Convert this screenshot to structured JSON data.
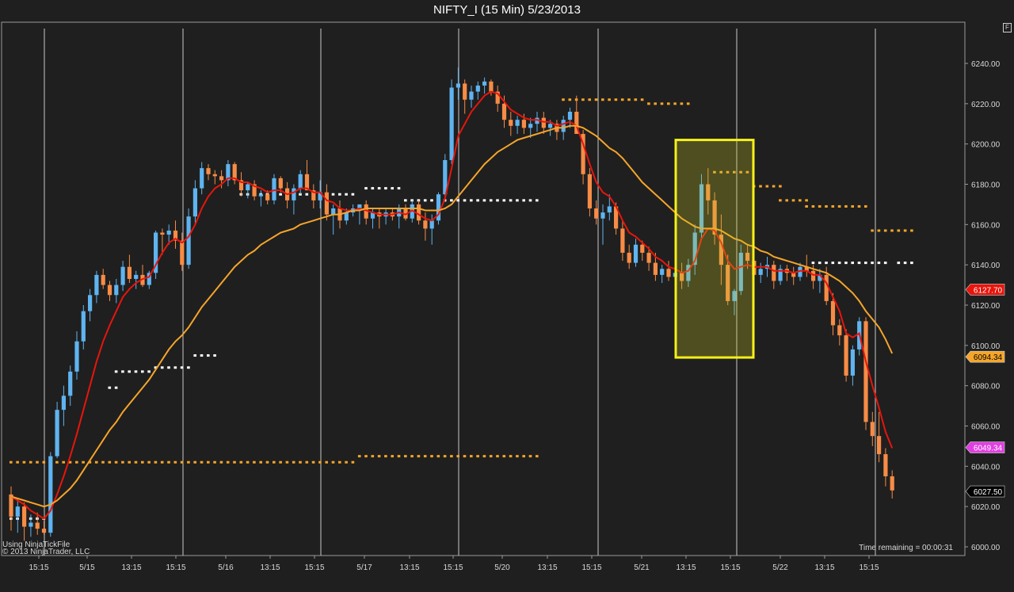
{
  "window": {
    "title": "NIFTY_I (15 Min)  5/23/2013",
    "corner_button": "F"
  },
  "footer": {
    "source_line": "Using NinjaTickFile",
    "copyright": "© 2013 NinjaTrader, LLC",
    "time_remaining": "Time remaining = 00:00:31"
  },
  "colors": {
    "background": "#1f1f1f",
    "up_candle": "#5fb4f0",
    "down_candle": "#f78c46",
    "fast_ma": "#e8150c",
    "slow_ma": "#f5a52a",
    "highlight_box": "#f6f018"
  },
  "chart_data": {
    "type": "candlestick",
    "title": "NIFTY_I (15 Min)  5/23/2013",
    "interval": "15 Min",
    "ylim": [
      5995,
      6253
    ],
    "y_ticks": [
      6000,
      6020,
      6040,
      6060,
      6080,
      6100,
      6120,
      6140,
      6160,
      6180,
      6200,
      6220,
      6240
    ],
    "y_tick_labels": [
      "6000.00",
      "6020.00",
      "6040.00",
      "6060.00",
      "6080.00",
      "6100.00",
      "6120.00",
      "6140.00",
      "6160.00",
      "6180.00",
      "6200.00",
      "6220.00",
      "6240.00"
    ],
    "x_tick_labels": [
      "15:15",
      "5/15",
      "13:15",
      "15:15",
      "5/16",
      "13:15",
      "15:15",
      "5/17",
      "13:15",
      "15:15",
      "5/20",
      "13:15",
      "15:15",
      "5/21",
      "13:15",
      "15:15",
      "5/22",
      "13:15",
      "15:15"
    ],
    "day_separators": 7,
    "candles": [
      [
        6026,
        6030,
        6008,
        6015
      ],
      [
        6015,
        6024,
        6007,
        6020
      ],
      [
        6020,
        6022,
        6003,
        6010
      ],
      [
        6010,
        6016,
        6005,
        6012
      ],
      [
        6012,
        6017,
        6006,
        6009
      ],
      [
        6009,
        6013,
        6006,
        6007
      ],
      [
        6007,
        6047,
        6005,
        6045
      ],
      [
        6045,
        6072,
        6044,
        6068
      ],
      [
        6068,
        6080,
        6060,
        6075
      ],
      [
        6075,
        6090,
        6070,
        6087
      ],
      [
        6087,
        6107,
        6083,
        6102
      ],
      [
        6102,
        6120,
        6098,
        6117
      ],
      [
        6117,
        6128,
        6112,
        6125
      ],
      [
        6125,
        6137,
        6121,
        6135
      ],
      [
        6135,
        6138,
        6128,
        6130
      ],
      [
        6130,
        6132,
        6122,
        6125
      ],
      [
        6125,
        6133,
        6121,
        6130
      ],
      [
        6130,
        6142,
        6127,
        6139
      ],
      [
        6139,
        6145,
        6131,
        6133
      ],
      [
        6133,
        6137,
        6128,
        6135
      ],
      [
        6135,
        6140,
        6129,
        6130
      ],
      [
        6130,
        6137,
        6128,
        6136
      ],
      [
        6136,
        6157,
        6133,
        6156
      ],
      [
        6156,
        6158,
        6145,
        6155
      ],
      [
        6155,
        6160,
        6150,
        6157
      ],
      [
        6157,
        6162,
        6148,
        6152
      ],
      [
        6152,
        6156,
        6137,
        6140
      ],
      [
        6140,
        6168,
        6138,
        6164
      ],
      [
        6164,
        6182,
        6160,
        6178
      ],
      [
        6178,
        6191,
        6175,
        6188
      ],
      [
        6188,
        6190,
        6182,
        6185
      ],
      [
        6185,
        6187,
        6180,
        6184
      ],
      [
        6184,
        6187,
        6178,
        6182
      ],
      [
        6182,
        6192,
        6179,
        6190
      ],
      [
        6190,
        6191,
        6180,
        6182
      ],
      [
        6182,
        6186,
        6174,
        6177
      ],
      [
        6177,
        6181,
        6173,
        6180
      ],
      [
        6180,
        6182,
        6172,
        6174
      ],
      [
        6174,
        6177,
        6169,
        6175
      ],
      [
        6175,
        6177,
        6170,
        6172
      ],
      [
        6172,
        6185,
        6170,
        6183
      ],
      [
        6183,
        6184,
        6176,
        6178
      ],
      [
        6178,
        6181,
        6168,
        6172
      ],
      [
        6172,
        6180,
        6165,
        6178
      ],
      [
        6178,
        6187,
        6175,
        6185
      ],
      [
        6185,
        6192,
        6180,
        6177
      ],
      [
        6177,
        6180,
        6168,
        6172
      ],
      [
        6172,
        6182,
        6168,
        6176
      ],
      [
        6176,
        6180,
        6162,
        6165
      ],
      [
        6165,
        6170,
        6155,
        6168
      ],
      [
        6168,
        6172,
        6158,
        6162
      ],
      [
        6162,
        6168,
        6160,
        6166
      ],
      [
        6166,
        6170,
        6164,
        6168
      ],
      [
        6168,
        6170,
        6160,
        6170
      ],
      [
        6170,
        6172,
        6160,
        6163
      ],
      [
        6163,
        6168,
        6158,
        6166
      ],
      [
        6166,
        6168,
        6158,
        6164
      ],
      [
        6164,
        6168,
        6160,
        6166
      ],
      [
        6166,
        6168,
        6162,
        6164
      ],
      [
        6164,
        6170,
        6158,
        6168
      ],
      [
        6168,
        6170,
        6162,
        6163
      ],
      [
        6163,
        6172,
        6161,
        6170
      ],
      [
        6170,
        6172,
        6160,
        6162
      ],
      [
        6162,
        6166,
        6152,
        6158
      ],
      [
        6158,
        6165,
        6150,
        6162
      ],
      [
        6162,
        6176,
        6160,
        6175
      ],
      [
        6175,
        6195,
        6172,
        6192
      ],
      [
        6192,
        6232,
        6190,
        6228
      ],
      [
        6228,
        6238,
        6222,
        6230
      ],
      [
        6230,
        6232,
        6215,
        6222
      ],
      [
        6222,
        6229,
        6218,
        6226
      ],
      [
        6226,
        6231,
        6222,
        6229
      ],
      [
        6229,
        6233,
        6225,
        6231
      ],
      [
        6231,
        6232,
        6224,
        6226
      ],
      [
        6226,
        6229,
        6216,
        6220
      ],
      [
        6220,
        6224,
        6208,
        6212
      ],
      [
        6212,
        6216,
        6204,
        6209
      ],
      [
        6209,
        6214,
        6205,
        6212
      ],
      [
        6212,
        6215,
        6205,
        6208
      ],
      [
        6208,
        6213,
        6203,
        6210
      ],
      [
        6210,
        6216,
        6206,
        6213
      ],
      [
        6213,
        6216,
        6205,
        6208
      ],
      [
        6208,
        6212,
        6204,
        6210
      ],
      [
        6210,
        6212,
        6202,
        6206
      ],
      [
        6206,
        6214,
        6202,
        6212
      ],
      [
        6212,
        6218,
        6208,
        6216
      ],
      [
        6216,
        6224,
        6210,
        6205
      ],
      [
        6205,
        6207,
        6180,
        6185
      ],
      [
        6185,
        6188,
        6164,
        6168
      ],
      [
        6168,
        6172,
        6160,
        6163
      ],
      [
        6163,
        6170,
        6150,
        6166
      ],
      [
        6166,
        6175,
        6162,
        6169
      ],
      [
        6169,
        6171,
        6155,
        6158
      ],
      [
        6158,
        6162,
        6142,
        6146
      ],
      [
        6146,
        6150,
        6138,
        6141
      ],
      [
        6141,
        6153,
        6139,
        6150
      ],
      [
        6150,
        6152,
        6142,
        6146
      ],
      [
        6146,
        6149,
        6137,
        6141
      ],
      [
        6141,
        6146,
        6132,
        6135
      ],
      [
        6135,
        6140,
        6131,
        6138
      ],
      [
        6138,
        6142,
        6132,
        6134
      ],
      [
        6134,
        6140,
        6130,
        6136
      ],
      [
        6136,
        6141,
        6128,
        6132
      ],
      [
        6132,
        6143,
        6129,
        6140
      ],
      [
        6140,
        6160,
        6135,
        6156
      ],
      [
        6156,
        6185,
        6153,
        6180
      ],
      [
        6180,
        6188,
        6165,
        6172
      ],
      [
        6172,
        6176,
        6150,
        6155
      ],
      [
        6155,
        6165,
        6130,
        6140
      ],
      [
        6140,
        6145,
        6120,
        6122
      ],
      [
        6122,
        6128,
        6115,
        6127
      ],
      [
        6127,
        6150,
        6125,
        6146
      ],
      [
        6146,
        6150,
        6138,
        6142
      ],
      [
        6142,
        6145,
        6130,
        6135
      ],
      [
        6135,
        6141,
        6131,
        6138
      ],
      [
        6138,
        6144,
        6134,
        6140
      ],
      [
        6140,
        6142,
        6128,
        6132
      ],
      [
        6132,
        6140,
        6130,
        6138
      ],
      [
        6138,
        6140,
        6132,
        6136
      ],
      [
        6136,
        6139,
        6130,
        6134
      ],
      [
        6134,
        6141,
        6132,
        6139
      ],
      [
        6139,
        6145,
        6134,
        6137
      ],
      [
        6137,
        6140,
        6128,
        6132
      ],
      [
        6132,
        6138,
        6126,
        6135
      ],
      [
        6135,
        6139,
        6120,
        6122
      ],
      [
        6122,
        6126,
        6105,
        6110
      ],
      [
        6110,
        6113,
        6100,
        6105
      ],
      [
        6105,
        6108,
        6082,
        6085
      ],
      [
        6085,
        6100,
        6080,
        6098
      ],
      [
        6098,
        6114,
        6095,
        6112
      ],
      [
        6112,
        6114,
        6058,
        6062
      ],
      [
        6062,
        6067,
        6050,
        6055
      ],
      [
        6055,
        6067,
        6042,
        6046
      ],
      [
        6046,
        6049,
        6030,
        6035
      ],
      [
        6035,
        6038,
        6024,
        6028
      ]
    ],
    "series": [
      {
        "name": "",
        "color": "#e8150c",
        "values": [
          6025,
          6023,
          6021,
          6018,
          6016,
          6014,
          6018,
          6026,
          6035,
          6045,
          6056,
          6068,
          6080,
          6092,
          6102,
          6110,
          6117,
          6124,
          6128,
          6131,
          6133,
          6134,
          6140,
          6146,
          6151,
          6153,
          6151,
          6154,
          6160,
          6168,
          6174,
          6178,
          6180,
          6183,
          6183,
          6181,
          6181,
          6179,
          6178,
          6176,
          6177,
          6177,
          6175,
          6176,
          6178,
          6178,
          6176,
          6176,
          6172,
          6171,
          6168,
          6167,
          6167,
          6168,
          6167,
          6166,
          6165,
          6165,
          6165,
          6166,
          6165,
          6167,
          6165,
          6163,
          6162,
          6165,
          6173,
          6188,
          6204,
          6210,
          6216,
          6220,
          6224,
          6226,
          6225,
          6221,
          6217,
          6215,
          6213,
          6212,
          6212,
          6211,
          6211,
          6209,
          6210,
          6211,
          6209,
          6200,
          6190,
          6181,
          6176,
          6174,
          6169,
          6162,
          6156,
          6154,
          6151,
          6148,
          6144,
          6142,
          6139,
          6138,
          6136,
          6137,
          6142,
          6153,
          6158,
          6157,
          6151,
          6142,
          6138,
          6139,
          6140,
          6139,
          6139,
          6139,
          6137,
          6137,
          6137,
          6136,
          6137,
          6137,
          6135,
          6135,
          6131,
          6124,
          6117,
          6106,
          6104,
          6106,
          6092,
          6080,
          6069,
          6057,
          6049
        ]
      },
      {
        "name": "",
        "color": "#f5a52a",
        "values": [
          6025,
          6024,
          6023,
          6022,
          6021,
          6020,
          6021,
          6023,
          6026,
          6029,
          6033,
          6038,
          6043,
          6048,
          6053,
          6058,
          6062,
          6067,
          6071,
          6075,
          6079,
          6083,
          6088,
          6093,
          6098,
          6102,
          6105,
          6109,
          6114,
          6119,
          6123,
          6127,
          6131,
          6135,
          6139,
          6142,
          6145,
          6147,
          6150,
          6152,
          6154,
          6156,
          6157,
          6158,
          6160,
          6161,
          6162,
          6163,
          6164,
          6165,
          6165,
          6166,
          6167,
          6167,
          6168,
          6168,
          6168,
          6168,
          6168,
          6168,
          6168,
          6168,
          6168,
          6167,
          6167,
          6167,
          6168,
          6170,
          6174,
          6178,
          6182,
          6186,
          6190,
          6193,
          6196,
          6198,
          6200,
          6202,
          6203,
          6204,
          6205,
          6206,
          6207,
          6208,
          6208,
          6209,
          6209,
          6208,
          6206,
          6204,
          6201,
          6198,
          6196,
          6193,
          6189,
          6185,
          6181,
          6178,
          6175,
          6172,
          6169,
          6166,
          6163,
          6161,
          6159,
          6158,
          6158,
          6158,
          6157,
          6155,
          6153,
          6152,
          6150,
          6149,
          6147,
          6146,
          6144,
          6143,
          6142,
          6141,
          6140,
          6139,
          6138,
          6137,
          6136,
          6134,
          6132,
          6129,
          6126,
          6122,
          6117,
          6113,
          6109,
          6103,
          6096
        ]
      }
    ],
    "dotted_levels": [
      {
        "price": 6014,
        "from": 0,
        "to": 6,
        "color": "#ffffff"
      },
      {
        "price": 6042,
        "from": 0,
        "to": 52,
        "color": "#f5a52a"
      },
      {
        "price": 6045,
        "from": 53,
        "to": 80,
        "color": "#f5a52a"
      },
      {
        "price": 6079,
        "from": 15,
        "to": 16,
        "color": "#ffffff"
      },
      {
        "price": 6087,
        "from": 16,
        "to": 21,
        "color": "#ffffff"
      },
      {
        "price": 6089,
        "from": 22,
        "to": 27,
        "color": "#ffffff"
      },
      {
        "price": 6095,
        "from": 28,
        "to": 31,
        "color": "#ffffff"
      },
      {
        "price": 6175,
        "from": 35,
        "to": 52,
        "color": "#ffffff"
      },
      {
        "price": 6178,
        "from": 54,
        "to": 59,
        "color": "#ffffff"
      },
      {
        "price": 6172,
        "from": 60,
        "to": 80,
        "color": "#ffffff"
      },
      {
        "price": 6222,
        "from": 84,
        "to": 96,
        "color": "#f5a52a"
      },
      {
        "price": 6220,
        "from": 97,
        "to": 103,
        "color": "#f5a52a"
      },
      {
        "price": 6186,
        "from": 107,
        "to": 112,
        "color": "#f5a52a"
      },
      {
        "price": 6179,
        "from": 113,
        "to": 117,
        "color": "#f5a52a"
      },
      {
        "price": 6172,
        "from": 117,
        "to": 121,
        "color": "#f5a52a"
      },
      {
        "price": 6169,
        "from": 121,
        "to": 130,
        "color": "#f5a52a"
      },
      {
        "price": 6157,
        "from": 131,
        "to": 153,
        "color": "#f5a52a"
      },
      {
        "price": 6141,
        "from": 122,
        "to": 133,
        "color": "#ffffff"
      },
      {
        "price": 6141,
        "from": 135,
        "to": 153,
        "color": "#ffffff"
      },
      {
        "price": 6143,
        "from": 158,
        "to": 162,
        "color": "#e8150c"
      },
      {
        "price": 6130,
        "from": 160,
        "to": 164,
        "color": "#e8150c"
      },
      {
        "price": 6112,
        "from": 157,
        "to": 160,
        "color": "#ff2be0"
      },
      {
        "price": 6052,
        "from": 162,
        "to": 164,
        "color": "#ffffff"
      }
    ],
    "price_markers": [
      {
        "label": "6127.70",
        "price": 6127.7,
        "bg": "#e8150c",
        "fg": "#ffffff"
      },
      {
        "label": "6094.34",
        "price": 6094.34,
        "bg": "#f5a52a",
        "fg": "#000000"
      },
      {
        "label": "6049.34",
        "price": 6049.34,
        "bg": "#e040e0",
        "fg": "#ffffff"
      },
      {
        "label": "6027.50",
        "price": 6027.5,
        "bg": "#000000",
        "fg": "#ffffff"
      }
    ],
    "highlight_region": {
      "from_candle": 122,
      "to_candle": 135,
      "price_top": 6202,
      "price_bottom": 6094
    }
  }
}
